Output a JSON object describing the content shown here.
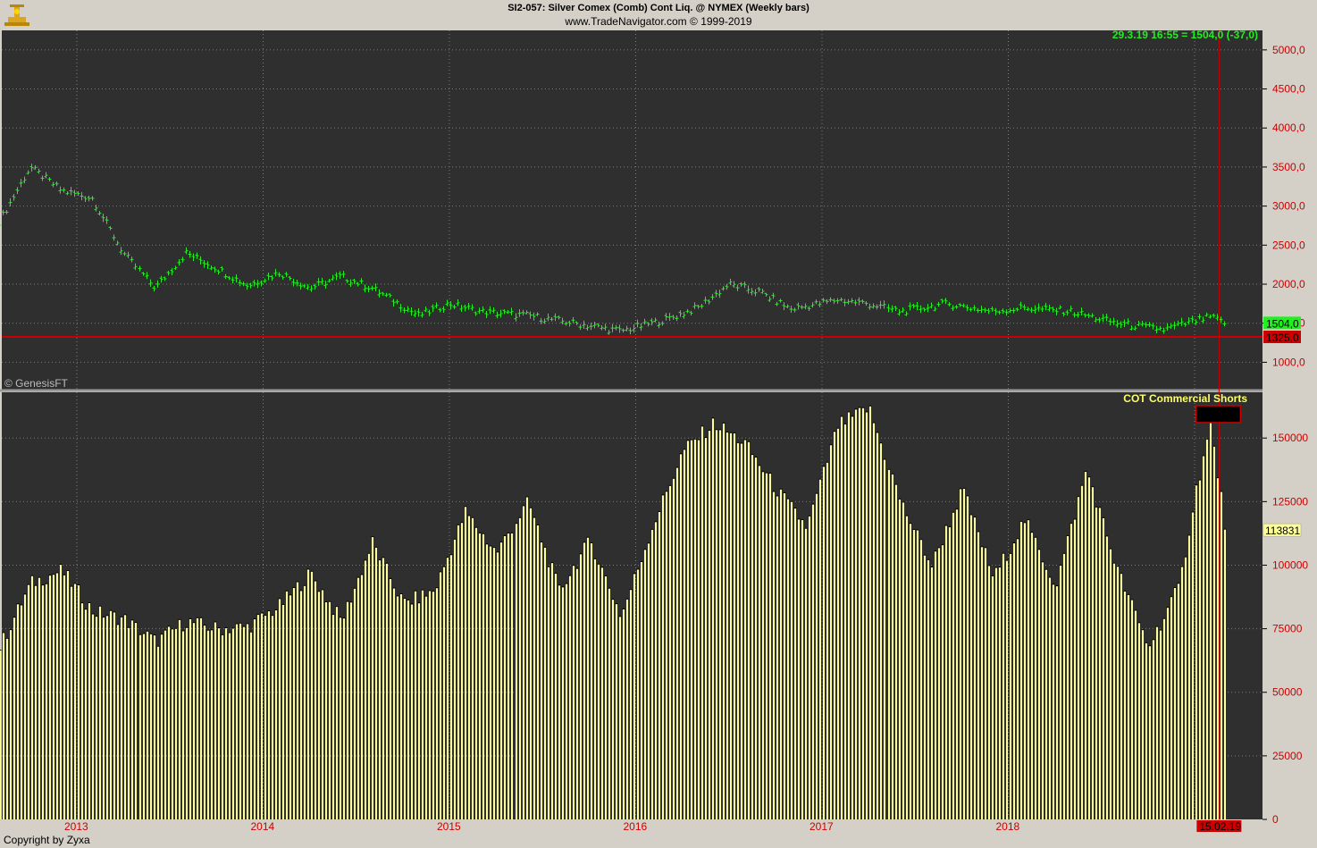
{
  "header": {
    "title": "SI2-057:  Silver Comex (Comb) Cont Liq. @ NYMEX  (Weekly bars)",
    "subtitle": "www.TradeNavigator.com © 1999-2019"
  },
  "footer": {
    "copyright": "Copyright by Zyxa"
  },
  "price_panel": {
    "readout": "29.3.19 16:55 = 1504,0 (-37,0)",
    "watermark": "© GenesisFT",
    "last_price_label": "1504,0",
    "line_label": "1325,0",
    "horizontal_line_value": 1325,
    "colors": {
      "bars": "#22ee22",
      "line": "#cc0000",
      "background": "#2f2f2f"
    }
  },
  "cot_panel": {
    "title": "COT Commercial Shorts",
    "last_value_label": "113831",
    "marker_date_label": "15.02.19",
    "colors": {
      "bars": "#ffff99",
      "background": "#2f2f2f"
    }
  },
  "chart_data": [
    {
      "type": "ohlc",
      "title": "SI2-057:  Silver Comex (Comb) Cont Liq. @ NYMEX  (Weekly bars)",
      "ylim": [
        650,
        5250
      ],
      "yticks": [
        "1000,0",
        "1500,0",
        "2000,0",
        "2500,0",
        "3000,0",
        "3500,0",
        "4000,0",
        "4500,0",
        "5000,0"
      ],
      "ytick_values": [
        1000,
        1500,
        2000,
        2500,
        3000,
        3500,
        4000,
        4500,
        5000
      ],
      "xlabels": [
        "2013",
        "2014",
        "2015",
        "2016",
        "2017",
        "2018",
        "2019"
      ],
      "x_date_range": [
        "2012-08",
        "2019-04"
      ],
      "key_points": [
        {
          "date": "2012-08",
          "close": 2800
        },
        {
          "date": "2012-10",
          "close": 3500
        },
        {
          "date": "2012-12",
          "close": 3200
        },
        {
          "date": "2013-02",
          "close": 3100
        },
        {
          "date": "2013-04",
          "close": 2400
        },
        {
          "date": "2013-06",
          "close": 1950
        },
        {
          "date": "2013-08",
          "close": 2400
        },
        {
          "date": "2013-10",
          "close": 2200
        },
        {
          "date": "2013-12",
          "close": 1980
        },
        {
          "date": "2014-02",
          "close": 2150
        },
        {
          "date": "2014-04",
          "close": 1950
        },
        {
          "date": "2014-06",
          "close": 2100
        },
        {
          "date": "2014-08",
          "close": 1950
        },
        {
          "date": "2014-11",
          "close": 1600
        },
        {
          "date": "2015-01",
          "close": 1750
        },
        {
          "date": "2015-03",
          "close": 1650
        },
        {
          "date": "2015-06",
          "close": 1600
        },
        {
          "date": "2015-09",
          "close": 1500
        },
        {
          "date": "2015-12",
          "close": 1400
        },
        {
          "date": "2016-03",
          "close": 1550
        },
        {
          "date": "2016-05",
          "close": 1700
        },
        {
          "date": "2016-07",
          "close": 2000
        },
        {
          "date": "2016-09",
          "close": 1900
        },
        {
          "date": "2016-11",
          "close": 1680
        },
        {
          "date": "2017-02",
          "close": 1800
        },
        {
          "date": "2017-04",
          "close": 1750
        },
        {
          "date": "2017-06",
          "close": 1650
        },
        {
          "date": "2017-09",
          "close": 1750
        },
        {
          "date": "2017-12",
          "close": 1650
        },
        {
          "date": "2018-02",
          "close": 1700
        },
        {
          "date": "2018-05",
          "close": 1650
        },
        {
          "date": "2018-08",
          "close": 1500
        },
        {
          "date": "2018-11",
          "close": 1420
        },
        {
          "date": "2019-02",
          "close": 1580
        },
        {
          "date": "2019-03",
          "close": 1504
        }
      ]
    },
    {
      "type": "bar",
      "title": "COT Commercial Shorts",
      "ylim": [
        0,
        168000
      ],
      "yticks": [
        "0",
        "25000",
        "50000",
        "75000",
        "100000",
        "125000",
        "150000"
      ],
      "ytick_values": [
        0,
        25000,
        50000,
        75000,
        100000,
        125000,
        150000
      ],
      "xlabels": [
        "2013",
        "2014",
        "2015",
        "2016",
        "2017",
        "2018",
        "15.02.19"
      ],
      "x_date_range": [
        "2012-08",
        "2019-04"
      ],
      "key_points": [
        {
          "date": "2012-08",
          "value": 68000
        },
        {
          "date": "2012-10",
          "value": 93000
        },
        {
          "date": "2012-12",
          "value": 98000
        },
        {
          "date": "2013-02",
          "value": 82000
        },
        {
          "date": "2013-04",
          "value": 79000
        },
        {
          "date": "2013-06",
          "value": 70000
        },
        {
          "date": "2013-08",
          "value": 78000
        },
        {
          "date": "2013-10",
          "value": 75000
        },
        {
          "date": "2013-12",
          "value": 76000
        },
        {
          "date": "2014-02",
          "value": 84000
        },
        {
          "date": "2014-04",
          "value": 97000
        },
        {
          "date": "2014-06",
          "value": 78000
        },
        {
          "date": "2014-08",
          "value": 109000
        },
        {
          "date": "2014-10",
          "value": 85000
        },
        {
          "date": "2014-12",
          "value": 90000
        },
        {
          "date": "2015-02",
          "value": 121000
        },
        {
          "date": "2015-04",
          "value": 105000
        },
        {
          "date": "2015-06",
          "value": 125000
        },
        {
          "date": "2015-08",
          "value": 90000
        },
        {
          "date": "2015-10",
          "value": 110000
        },
        {
          "date": "2015-12",
          "value": 80000
        },
        {
          "date": "2016-02",
          "value": 115000
        },
        {
          "date": "2016-04",
          "value": 145000
        },
        {
          "date": "2016-06",
          "value": 156000
        },
        {
          "date": "2016-08",
          "value": 148000
        },
        {
          "date": "2016-10",
          "value": 130000
        },
        {
          "date": "2016-12",
          "value": 115000
        },
        {
          "date": "2017-02",
          "value": 155000
        },
        {
          "date": "2017-04",
          "value": 162000
        },
        {
          "date": "2017-06",
          "value": 125000
        },
        {
          "date": "2017-08",
          "value": 100000
        },
        {
          "date": "2017-10",
          "value": 130000
        },
        {
          "date": "2017-12",
          "value": 95000
        },
        {
          "date": "2018-02",
          "value": 118000
        },
        {
          "date": "2018-04",
          "value": 92000
        },
        {
          "date": "2018-06",
          "value": 138000
        },
        {
          "date": "2018-08",
          "value": 98000
        },
        {
          "date": "2018-10",
          "value": 68000
        },
        {
          "date": "2018-12",
          "value": 92000
        },
        {
          "date": "2019-01",
          "value": 128000
        },
        {
          "date": "2019-02",
          "value": 155000
        },
        {
          "date": "2019-03",
          "value": 113831
        }
      ]
    }
  ]
}
